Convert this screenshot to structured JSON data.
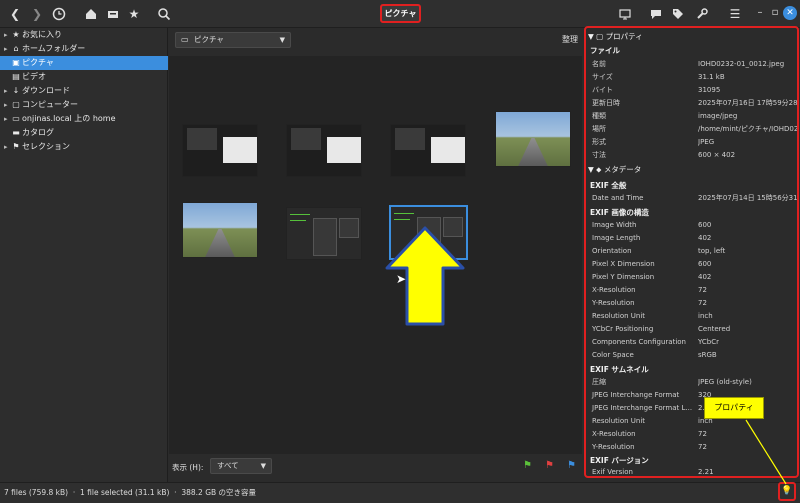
{
  "header": {
    "title": "ピクチャ",
    "icons": [
      "back-icon",
      "forward-icon",
      "history-icon",
      "home-icon",
      "drive-icon",
      "star-icon",
      "search-icon",
      "slideshow-icon",
      "comment-icon",
      "tag-icon",
      "wrench-icon",
      "menu-icon",
      "minimize-icon",
      "maximize-icon",
      "close-icon"
    ]
  },
  "sidebar": {
    "items": [
      {
        "label": "お気に入り",
        "icon": "★",
        "exp": "▸"
      },
      {
        "label": "ホームフォルダー",
        "icon": "⌂",
        "exp": "▸"
      },
      {
        "label": "ピクチャ",
        "icon": "▣",
        "exp": ""
      },
      {
        "label": "ビデオ",
        "icon": "▤",
        "exp": ""
      },
      {
        "label": "ダウンロード",
        "icon": "↓",
        "exp": "▸"
      },
      {
        "label": "コンピューター",
        "icon": "▢",
        "exp": "▸"
      },
      {
        "label": "onjinas.local 上の home",
        "icon": "▭",
        "exp": "▸"
      },
      {
        "label": "カタログ",
        "icon": "▬",
        "exp": ""
      },
      {
        "label": "セレクション",
        "icon": "⚑",
        "exp": "▸"
      }
    ]
  },
  "toolbar": {
    "location": "ピクチャ",
    "sort_label": "整理"
  },
  "bottom": {
    "view_label": "表示 (H):",
    "view_value": "すべて"
  },
  "properties": {
    "header": "プロパティ",
    "file_section": "ファイル",
    "file_rows": [
      {
        "k": "名前",
        "v": "IOHD0232-01_0012.jpeg"
      },
      {
        "k": "サイズ",
        "v": "31.1 kB"
      },
      {
        "k": "バイト",
        "v": "31095"
      },
      {
        "k": "更新日時",
        "v": "2025年07月16日 17時59分28秒"
      },
      {
        "k": "種類",
        "v": "image/jpeg"
      },
      {
        "k": "場所",
        "v": "/home/mint/ピクチャ/IOHD023..."
      },
      {
        "k": "形式",
        "v": "JPEG"
      },
      {
        "k": "寸法",
        "v": "600 × 402"
      }
    ],
    "meta_header": "メタデータ",
    "sections": [
      {
        "title": "EXIF 全般",
        "rows": [
          {
            "k": "Date and Time",
            "v": "2025年07月14日 15時56分31秒"
          }
        ]
      },
      {
        "title": "EXIF 画像の構造",
        "rows": [
          {
            "k": "Image Width",
            "v": "600"
          },
          {
            "k": "Image Length",
            "v": "402"
          },
          {
            "k": "Orientation",
            "v": "top, left"
          },
          {
            "k": "Pixel X Dimension",
            "v": "600"
          },
          {
            "k": "Pixel Y Dimension",
            "v": "402"
          },
          {
            "k": "X-Resolution",
            "v": "72"
          },
          {
            "k": "Y-Resolution",
            "v": "72"
          },
          {
            "k": "Resolution Unit",
            "v": "inch"
          },
          {
            "k": "YCbCr Positioning",
            "v": "Centered"
          },
          {
            "k": "Components Configuration",
            "v": "YCbCr"
          },
          {
            "k": "Color Space",
            "v": "sRGB"
          }
        ]
      },
      {
        "title": "EXIF サムネイル",
        "rows": [
          {
            "k": "圧縮",
            "v": "JPEG (old-style)"
          },
          {
            "k": "JPEG Interchange Format",
            "v": "320"
          },
          {
            "k": "JPEG Interchange Format L...",
            "v": "2..."
          },
          {
            "k": "Resolution Unit",
            "v": "inch"
          },
          {
            "k": "X-Resolution",
            "v": "72"
          },
          {
            "k": "Y-Resolution",
            "v": "72"
          }
        ]
      },
      {
        "title": "EXIF バージョン",
        "rows": [
          {
            "k": "Exif Version",
            "v": "2.21"
          }
        ]
      }
    ]
  },
  "status": {
    "text": "7 files (759.8 kB)  ·  1 file selected (31.1 kB)  ·  388.2 GB の空き容量"
  },
  "annotation": {
    "callout": "プロパティ"
  },
  "colors": {
    "accent": "#3b8ede",
    "highlight_red": "#e02020",
    "annotation_yellow": "#ffff00",
    "flag_green": "#5cc13b",
    "flag_red": "#e04040",
    "flag_blue": "#3b8ede"
  }
}
